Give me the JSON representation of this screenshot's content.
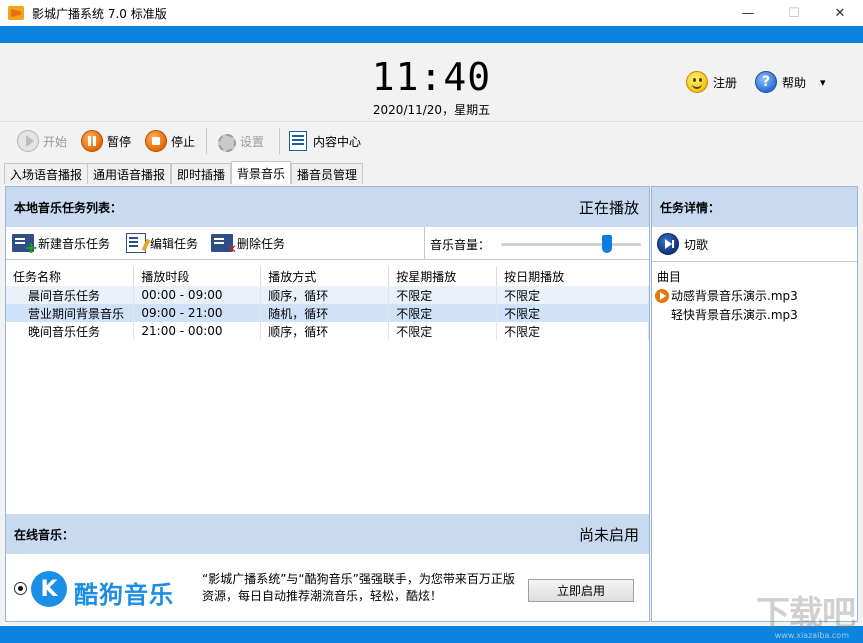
{
  "window": {
    "title": "影城广播系统 7.0 标准版",
    "minimize": "—",
    "maximize": "☐",
    "close": "✕"
  },
  "header": {
    "time": "11:40",
    "date": "2020/11/20，星期五",
    "register_label": "注册",
    "help_label": "帮助",
    "help_dropdown": "▾"
  },
  "toolbar": {
    "start_label": "开始",
    "pause_label": "暂停",
    "stop_label": "停止",
    "settings_label": "设置",
    "content_center_label": "内容中心"
  },
  "tabs": [
    {
      "label": "入场语音播报",
      "active": false
    },
    {
      "label": "通用语音播报",
      "active": false
    },
    {
      "label": "即时插播",
      "active": false
    },
    {
      "label": "背景音乐",
      "active": true
    },
    {
      "label": "播音员管理",
      "active": false
    }
  ],
  "local_panel": {
    "title": "本地音乐任务列表：",
    "status": "正在播放",
    "new_task_label": "新建音乐任务",
    "edit_task_label": "编辑任务",
    "delete_task_label": "删除任务",
    "volume_label": "音乐音量：",
    "volume_level": 0.76,
    "columns": [
      "任务名称",
      "播放时段",
      "播放方式",
      "按星期播放",
      "按日期播放"
    ],
    "rows": [
      [
        "晨间音乐任务",
        "00:00 - 09:00",
        "顺序，循环",
        "不限定",
        "不限定"
      ],
      [
        "营业期间背景音乐",
        "09:00 - 21:00",
        "随机，循环",
        "不限定",
        "不限定"
      ],
      [
        "晚间音乐任务",
        "21:00 - 00:00",
        "顺序，循环",
        "不限定",
        "不限定"
      ]
    ]
  },
  "online_panel": {
    "title": "在线音乐：",
    "status": "尚未启用",
    "logo_letter": "K",
    "brand_name": "酷狗音乐",
    "promo_text": "“影城广播系统”与“酷狗音乐”强强联手，为您带来百万正版资源，每日自动推荐潮流音乐，轻松，酷炫！",
    "enable_label": "立即启用"
  },
  "detail_panel": {
    "title": "任务详情：",
    "skip_label": "切歌",
    "songs_header": "曲目",
    "songs": [
      {
        "name": "动感背景音乐演示.mp3",
        "playing": true
      },
      {
        "name": "轻快背景音乐演示.mp3",
        "playing": false
      }
    ]
  },
  "watermark": {
    "text": "下载吧",
    "url": "www.xiazaiba.com"
  }
}
